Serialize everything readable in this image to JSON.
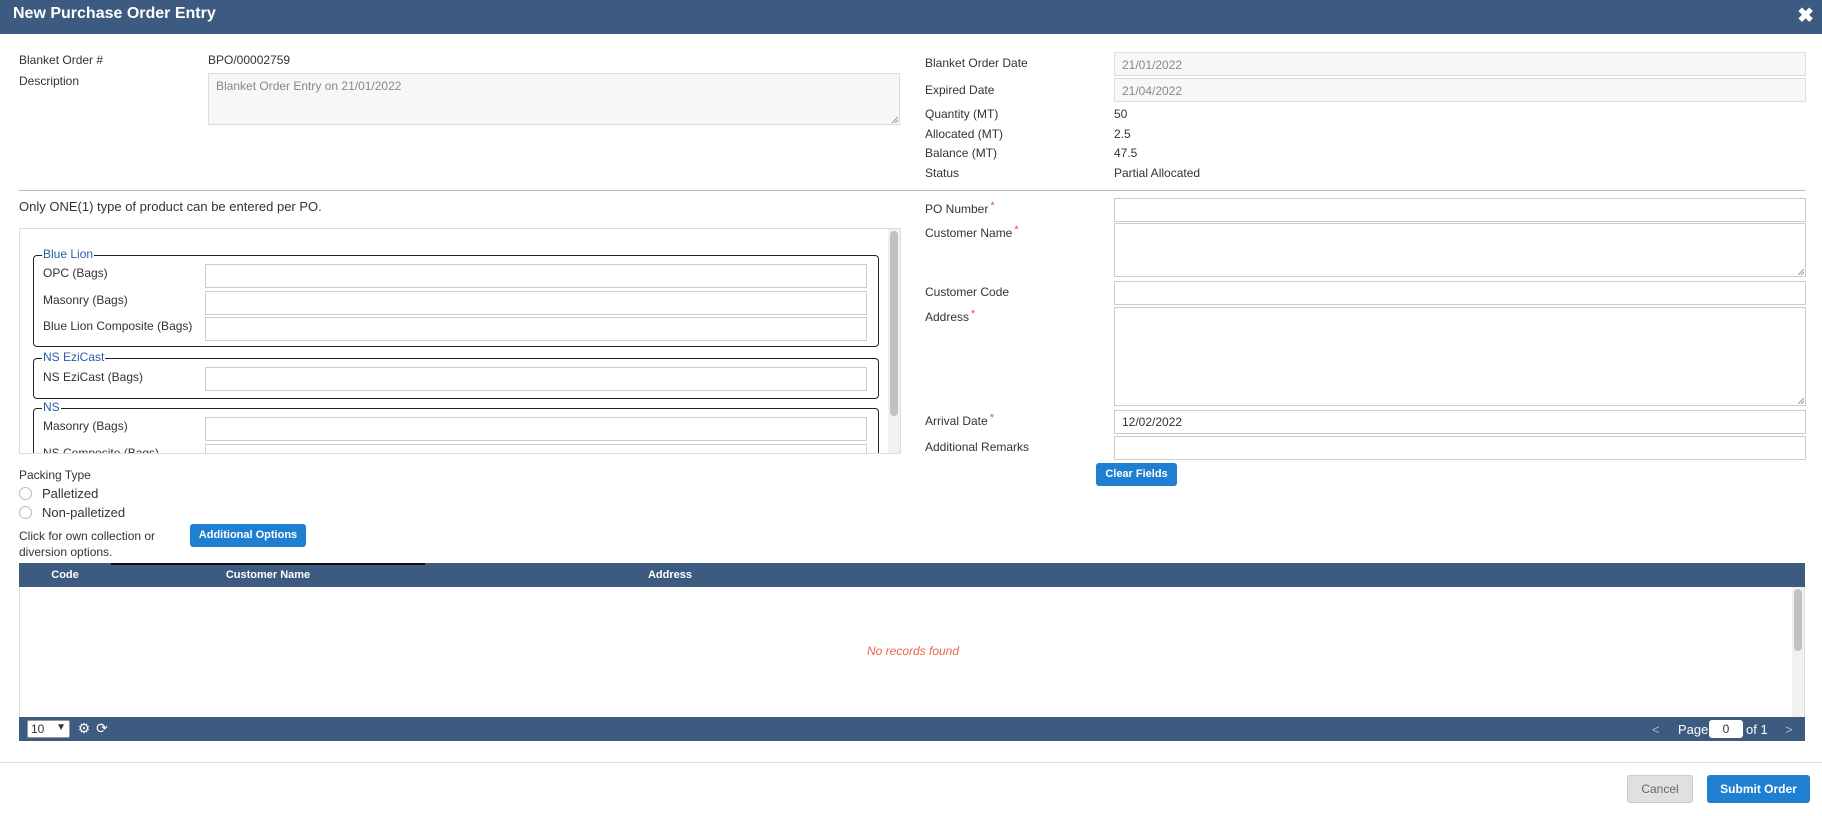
{
  "window": {
    "title": "New Purchase Order Entry"
  },
  "order": {
    "blanket_order_label": "Blanket Order #",
    "blanket_order_value": "BPO/00002759",
    "description_label": "Description",
    "description_value": "Blanket Order Entry on 21/01/2022",
    "date_label": "Blanket Order Date",
    "date_value": "21/01/2022",
    "expired_label": "Expired Date",
    "expired_value": "21/04/2022",
    "quantity_label": "Quantity (MT)",
    "quantity_value": "50",
    "allocated_label": "Allocated (MT)",
    "allocated_value": "2.5",
    "balance_label": "Balance (MT)",
    "balance_value": "47.5",
    "status_label": "Status",
    "status_value": "Partial Allocated"
  },
  "products": {
    "note": "Only ONE(1) type of product can be entered per PO.",
    "groups": [
      {
        "name": "Blue Lion",
        "items": [
          "OPC (Bags)",
          "Masonry (Bags)",
          "Blue Lion Composite (Bags)"
        ]
      },
      {
        "name": "NS EziCast",
        "items": [
          "NS EziCast (Bags)"
        ]
      },
      {
        "name": "NS",
        "items": [
          "Masonry (Bags)",
          "NS Composite (Bags)"
        ]
      }
    ]
  },
  "po": {
    "po_number_label": "PO Number",
    "customer_name_label": "Customer Name",
    "customer_code_label": "Customer Code",
    "address_label": "Address",
    "arrival_label": "Arrival Date",
    "arrival_value": "12/02/2022",
    "remarks_label": "Additional Remarks",
    "clear_button": "Clear Fields"
  },
  "packing": {
    "label": "Packing Type",
    "options": [
      "Palletized",
      "Non-palletized"
    ]
  },
  "options": {
    "hint": "Click for own collection or diversion options.",
    "button": "Additional Options"
  },
  "grid": {
    "columns": [
      "Code",
      "Customer Name",
      "Address"
    ],
    "empty_text": "No records found",
    "page_size": "10",
    "page_label": "Page",
    "page_value": "0",
    "page_of": "of 1",
    "prev": "<",
    "next": ">"
  },
  "footer": {
    "cancel": "Cancel",
    "submit": "Submit Order"
  },
  "colors": {
    "header": "#3d5a80",
    "primary_button": "#1f7fd1",
    "required": "#d9534f",
    "empty_text": "#e8684a",
    "legend": "#2a5ca8"
  },
  "icons": {
    "close": "close-icon",
    "settings": "gear-icon",
    "refresh": "refresh-icon"
  }
}
